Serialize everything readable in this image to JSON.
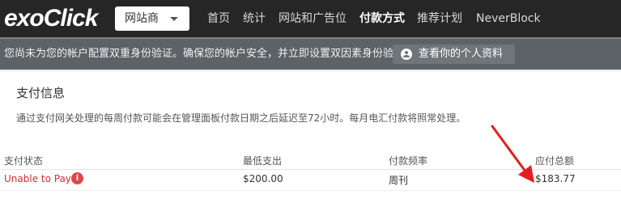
{
  "header": {
    "logo_text": "exoClick",
    "site_selector": "网站商",
    "nav": [
      "首页",
      "统计",
      "网站和广告位",
      "付款方式",
      "推荐计划",
      "NeverBlock"
    ],
    "active_nav": "付款方式"
  },
  "alert": {
    "message": "您尚未为您的帐户配置双重身份验证。确保您的帐户安全，并立即设置双因素身份验证。",
    "button": "查看你的个人资料"
  },
  "payment_info": {
    "title": "支付信息",
    "description": "通过支付网关处理的每周付款可能会在管理面板付款日期之后延迟至72小时。每月电汇付款将照常处理。"
  },
  "table": {
    "headers": [
      "支付状态",
      "最低支出",
      "付款频率",
      "应付总额"
    ],
    "row": {
      "status": "Unable to Pay",
      "minimum": "$200.00",
      "frequency": "周刊",
      "total": "$183.77"
    }
  },
  "colors": {
    "topbar": "#262626",
    "alert_bar": "#5d6266",
    "status_red": "#d32f2f",
    "arrow_red": "#e02020"
  },
  "icons": {
    "select_caret": "caret-down-icon",
    "profile": "user-circle-icon",
    "status_info": "info-circle-icon",
    "annotation": "red-arrow-icon"
  }
}
